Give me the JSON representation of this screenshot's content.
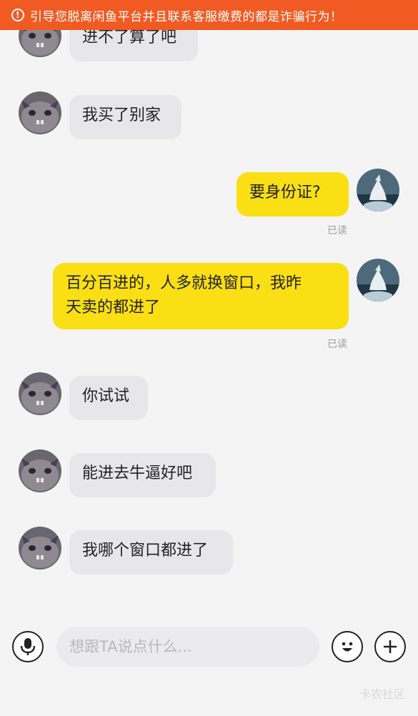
{
  "banner": {
    "icon": "exclamation-circle-icon",
    "text": "引导您脱离闲鱼平台并且联系客服缴费的都是诈骗行为！"
  },
  "messages": [
    {
      "side": "left",
      "text": "进不了算了吧"
    },
    {
      "side": "left",
      "text": "我买了别家"
    },
    {
      "side": "right",
      "text": "要身份证?",
      "status": "已读"
    },
    {
      "side": "right",
      "line1": "百分百进的，人多就换窗口，我昨",
      "line2": "天卖的都进了",
      "status": "已读"
    },
    {
      "side": "left",
      "text": "你试试"
    },
    {
      "side": "left",
      "text": "能进去牛逼好吧"
    },
    {
      "side": "left",
      "text": "我哪个窗口都进了"
    }
  ],
  "input": {
    "placeholder": "想跟TA说点什么...",
    "voice_icon": "microphone-icon",
    "emoji_icon": "emoji-icon",
    "plus_icon": "plus-icon"
  },
  "watermark": "卡农社区",
  "colors": {
    "banner": "#f15a22",
    "my_bubble": "#f9df13",
    "their_bubble": "#e7e7e9",
    "background": "#f4f4f4"
  }
}
